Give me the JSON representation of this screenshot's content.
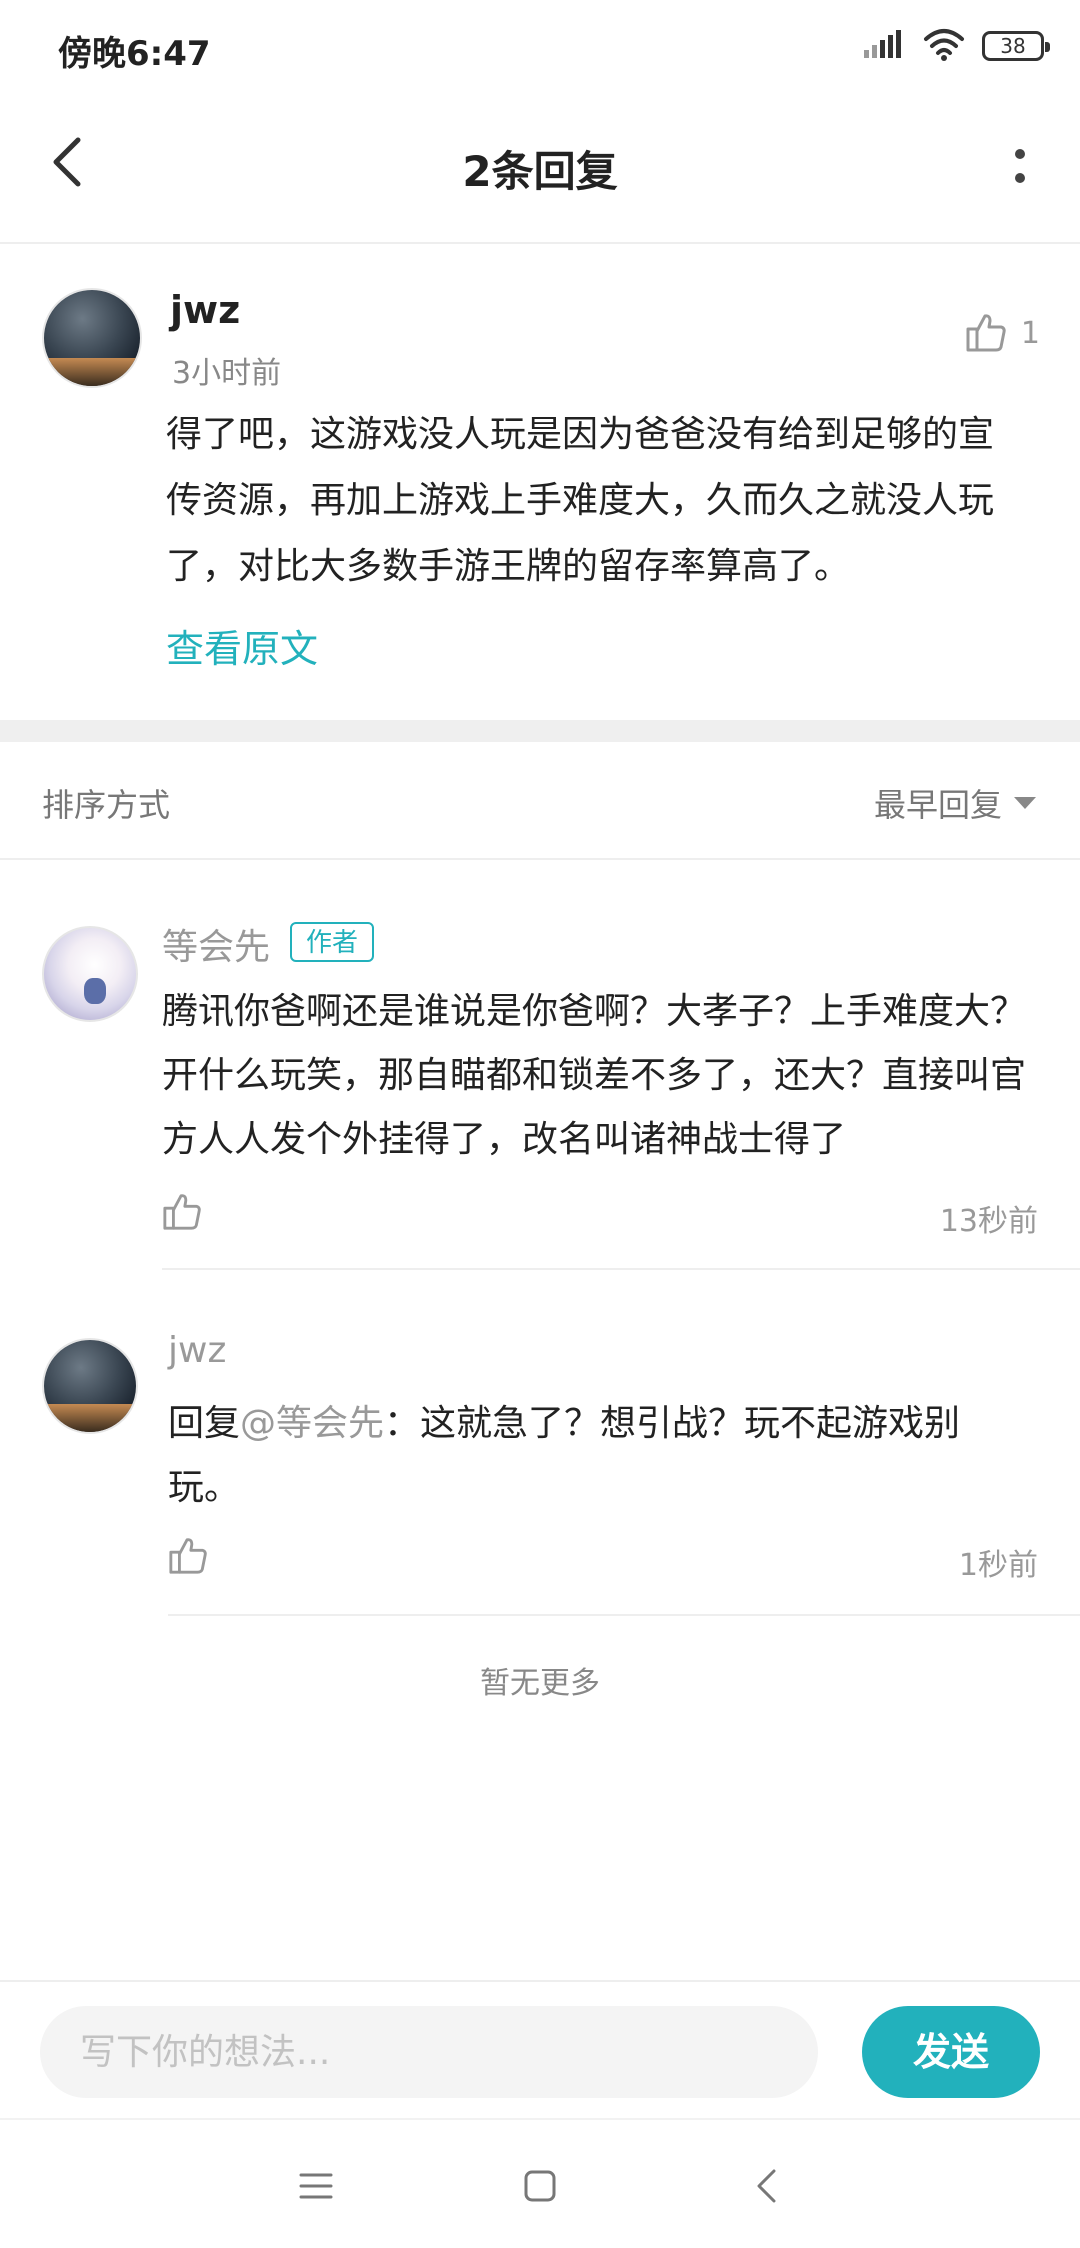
{
  "status_bar": {
    "time": "傍晚6:47",
    "battery": "38",
    "icons": [
      "signal-icon",
      "wifi-icon",
      "battery-icon"
    ]
  },
  "header": {
    "title": "2条回复",
    "back_icon": "back-arrow-icon",
    "more_icon": "more-vertical-icon"
  },
  "main_comment": {
    "author": "jwz",
    "time": "3小时前",
    "like_count": "1",
    "text": "得了吧，这游戏没人玩是因为爸爸没有给到足够的宣传资源，再加上游戏上手难度大，久而久之就没人玩了，对比大多数手游王牌的留存率算高了。",
    "view_original": "查看原文"
  },
  "sort": {
    "label": "排序方式",
    "selected": "最早回复"
  },
  "replies": [
    {
      "author": "等会先",
      "badge": "作者",
      "text": "腾讯你爸啊还是谁说是你爸啊？大孝子？上手难度大？开什么玩笑，那自瞄都和锁差不多了，还大？直接叫官方人人发个外挂得了，改名叫诸神战士得了",
      "time": "13秒前"
    },
    {
      "author": "jwz",
      "reply_prefix": "回复",
      "mention": "@等会先",
      "text": "：这就急了？想引战？玩不起游戏别玩。",
      "time": "1秒前"
    }
  ],
  "no_more": "暂无更多",
  "input": {
    "placeholder": "写下你的想法...",
    "value": "",
    "send_label": "发送"
  },
  "colors": {
    "accent": "#22b1bc",
    "muted": "#999999",
    "text": "#222222"
  }
}
